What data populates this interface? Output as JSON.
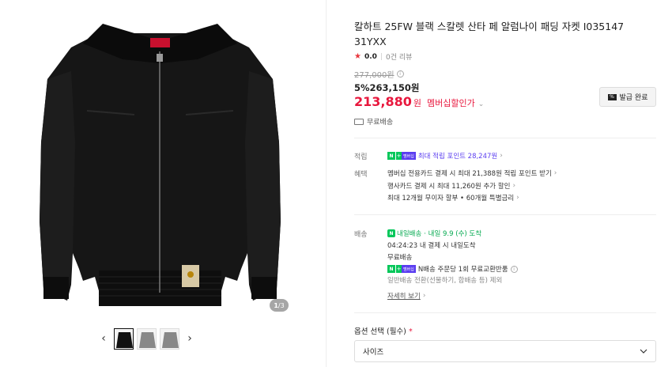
{
  "gallery": {
    "counter_current": "1",
    "counter_total": "/3",
    "prev_arrow": "‹",
    "next_arrow": "›"
  },
  "product": {
    "title": "칼하트 25FW 블랙 스칼렛 산타 페 알럼나이 패딩 자켓 I035147 31YXX",
    "rating": "0.0",
    "reviews": "0건 리뷰",
    "original_price": "277,000원",
    "discount_line": "5%263,150원",
    "sale_price": "213,880",
    "sale_won": "원",
    "member_label": "멤버십할인가",
    "coupon_label": "발급 완료",
    "shipping": "무료배송"
  },
  "points": {
    "label": "적립",
    "text": "최대 적립 포인트 28,247원",
    "badge_n": "N",
    "badge_plus": "+",
    "badge_member": "멤버십"
  },
  "benefits": {
    "label": "혜택",
    "lines": [
      "멤버십 전용카드 결제 시 최대 21,388원 적립 포인트 받기",
      "행사카드 결제 시 최대 11,260원 추가 할인",
      "최대 12개월 무이자 할부 • 60개월 특별금리"
    ]
  },
  "delivery": {
    "label": "배송",
    "today_badge": "N",
    "today_text": "내일배송",
    "arrival": "· 내일 9.9 (수) 도착",
    "cutoff": "04:24:23 내 결제 시 내일도착",
    "free": "무료배송",
    "exchange": "N배송 주문당 1회 무료교환반품",
    "excluded": "일반배송 전환(선물하기, 합배송 등) 제외",
    "more": "자세히 보기"
  },
  "options": {
    "label": "옵션 선택 (필수)",
    "required_mark": "*",
    "select_value": "사이즈"
  },
  "colors": {
    "price_red": "#e8173d",
    "naver_green": "#03c75a",
    "member_purple": "#5a3df0"
  }
}
